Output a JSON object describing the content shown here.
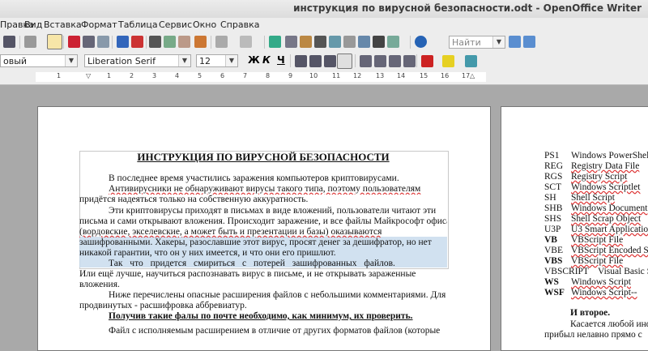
{
  "window": {
    "title": "инструкция по вирусной безопасности.odt - OpenOffice Writer"
  },
  "menu": [
    "Правка",
    "Вид",
    "Вставка",
    "Формат",
    "Таблица",
    "Сервис",
    "Окно",
    "Справка"
  ],
  "toolbar": {
    "search_placeholder": "Найти"
  },
  "format": {
    "style": "овый",
    "font": "Liberation Serif",
    "size": "12",
    "bold": "Ж",
    "italic": "К",
    "underline": "Ч"
  },
  "ruler": {
    "labels": [
      "1",
      "1",
      "2",
      "3",
      "4",
      "5",
      "6",
      "7",
      "8",
      "9",
      "10",
      "11",
      "12",
      "13",
      "14",
      "15",
      "16",
      "17",
      "18"
    ]
  },
  "document": {
    "heading": "ИНСТРУКЦИЯ ПО ВИРУСНОЙ БЕЗОПАСНОСТИ",
    "lines": [
      "В последнее время участились заражения компьютеров криптовирусами.",
      "Антивирусники не обнаруживают вирусы такого типа, поэтому пользователям",
      "придётся надеяться только на собственную аккуратность.",
      "Эти криптовирусы приходят в письмах в виде вложений, пользователи читают эти",
      "письма и сами открывают вложения. Происходит заражение, и все файлы Майкрософт офиса",
      "(вордовские, экселевские, а может быть и презентации и базы) оказываются",
      "зашифрованными. Хакеры, разославшие этот вирус, просят денег за дешифратор, но нет",
      "никакой гарантии, что он у них имеется, и что они его пришлют.",
      "Так что придется смириться с потерей зашифрованных файлов.",
      "Или ещё лучше, научиться распознавать вирус в письме, и не открывать зараженные",
      "вложения.",
      "Ниже перечислены опасные расширения файлов с небольшими комментариями. Для",
      "продвинутых - расшифровка аббревиатур.",
      "Получив такие фалы по почте необходимо, как минимум, их проверить.",
      "Файл с исполняемым расширением в отличие от других форматов файлов (которые"
    ]
  },
  "extensions": [
    {
      "ext": "PS1",
      "desc": "Windows PowerShell",
      "bold": false
    },
    {
      "ext": "REG",
      "desc": "Registry Data File",
      "bold": false
    },
    {
      "ext": "RGS",
      "desc": "Registry Script",
      "bold": false
    },
    {
      "ext": "SCT",
      "desc": "Windows Scriptlet",
      "bold": false
    },
    {
      "ext": "SH",
      "desc": "Shell Script",
      "bold": false
    },
    {
      "ext": "SHB",
      "desc": "Windows Document",
      "bold": false
    },
    {
      "ext": "SHS",
      "desc": "Shell Scrap Object",
      "bold": false
    },
    {
      "ext": "U3P",
      "desc": "U3 Smart Application",
      "bold": false
    },
    {
      "ext": "VB",
      "desc": "VBScript File",
      "bold": true
    },
    {
      "ext": "VBE",
      "desc": "VBScript Encoded Script",
      "bold": false
    },
    {
      "ext": "VBS",
      "desc": "VBScript File",
      "bold": true
    },
    {
      "ext": "VBSCRIPT",
      "desc": "Visual Basic Script",
      "bold": false
    },
    {
      "ext": "WS",
      "desc": "Windows Script",
      "bold": true
    },
    {
      "ext": "WSF",
      "desc": "Windows Script--",
      "bold": true
    }
  ],
  "right_page": {
    "secondly": "И второе.",
    "line1": "Касается любой инф",
    "line2": "прибыл нелавно прямо с"
  }
}
